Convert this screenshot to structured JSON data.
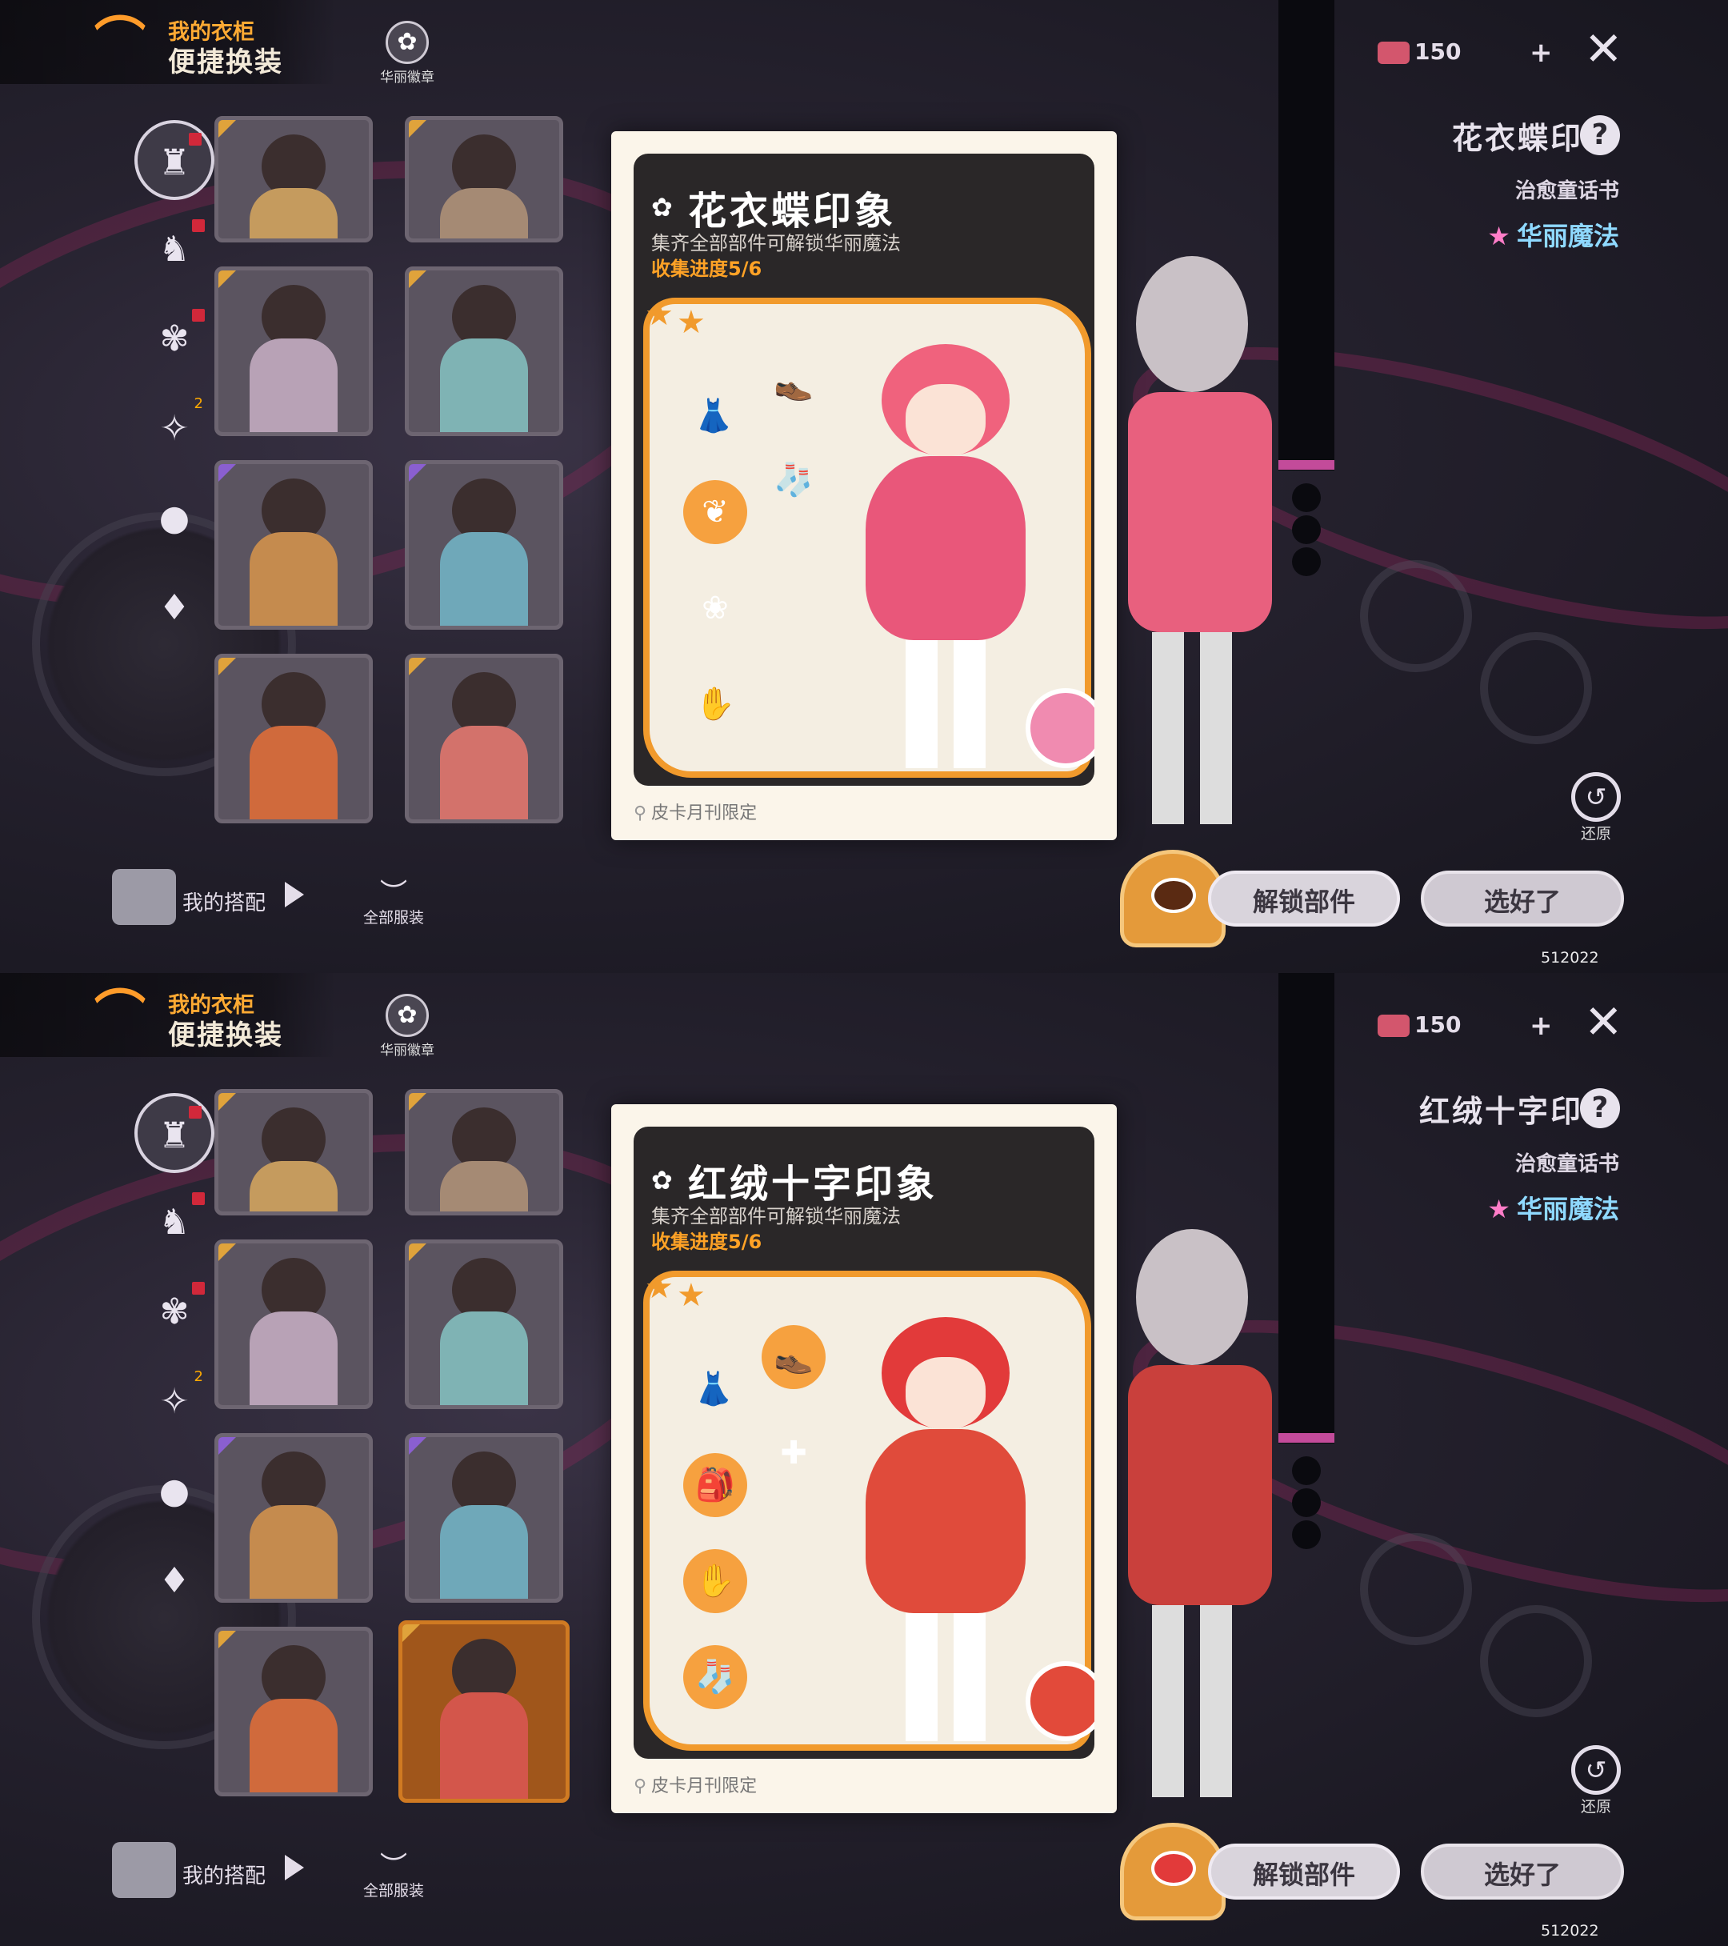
{
  "screens": [
    {
      "wardrobe_label": "我的衣柜",
      "quick_change_label": "便捷换装",
      "badge_label": "华丽徽章",
      "currency_value": "150",
      "plus_label": "+",
      "close_label": "✕",
      "outfit_name": "花衣蝶印象",
      "help_label": "?",
      "book_name": "治愈童话书",
      "magic_label": "华丽魔法",
      "card": {
        "title": "花衣蝶印象",
        "subtitle": "集齐全部部件可解锁华丽魔法",
        "progress": "收集进度5/6",
        "source": "皮卡月刊限定"
      },
      "restore_label": "还原",
      "unlock_label": "解锁部件",
      "done_label": "选好了",
      "build_id": "512022",
      "my_outfit_label": "我的搭配",
      "all_clothes_label": "全部服装",
      "colors": {
        "hair": "#f0627d",
        "dress": "#e9577a",
        "pet": "#f08bb0",
        "right_char": "#e8607e"
      }
    },
    {
      "wardrobe_label": "我的衣柜",
      "quick_change_label": "便捷换装",
      "badge_label": "华丽徽章",
      "currency_value": "150",
      "plus_label": "+",
      "close_label": "✕",
      "outfit_name": "红绒十字印象",
      "help_label": "?",
      "book_name": "治愈童话书",
      "magic_label": "华丽魔法",
      "card": {
        "title": "红绒十字印象",
        "subtitle": "集齐全部部件可解锁华丽魔法",
        "progress": "收集进度5/6",
        "source": "皮卡月刊限定"
      },
      "restore_label": "还原",
      "unlock_label": "解锁部件",
      "done_label": "选好了",
      "build_id": "512022",
      "my_outfit_label": "我的搭配",
      "all_clothes_label": "全部服装",
      "colors": {
        "hair": "#e23a3a",
        "dress": "#e04b3b",
        "pet": "#e24a3a",
        "right_char": "#c9403c"
      }
    }
  ],
  "icons": {
    "hanger": "hanger-icon",
    "badge": "flower-badge-icon",
    "sidebar": [
      "coat-icon",
      "outfit-icon",
      "accessory-icon",
      "wand-icon",
      "hair-icon",
      "nail-polish-icon"
    ],
    "location": "location-pin-icon",
    "restore": "restore-icon",
    "close": "close-icon",
    "help": "help-icon",
    "gift": "ticket-icon"
  }
}
